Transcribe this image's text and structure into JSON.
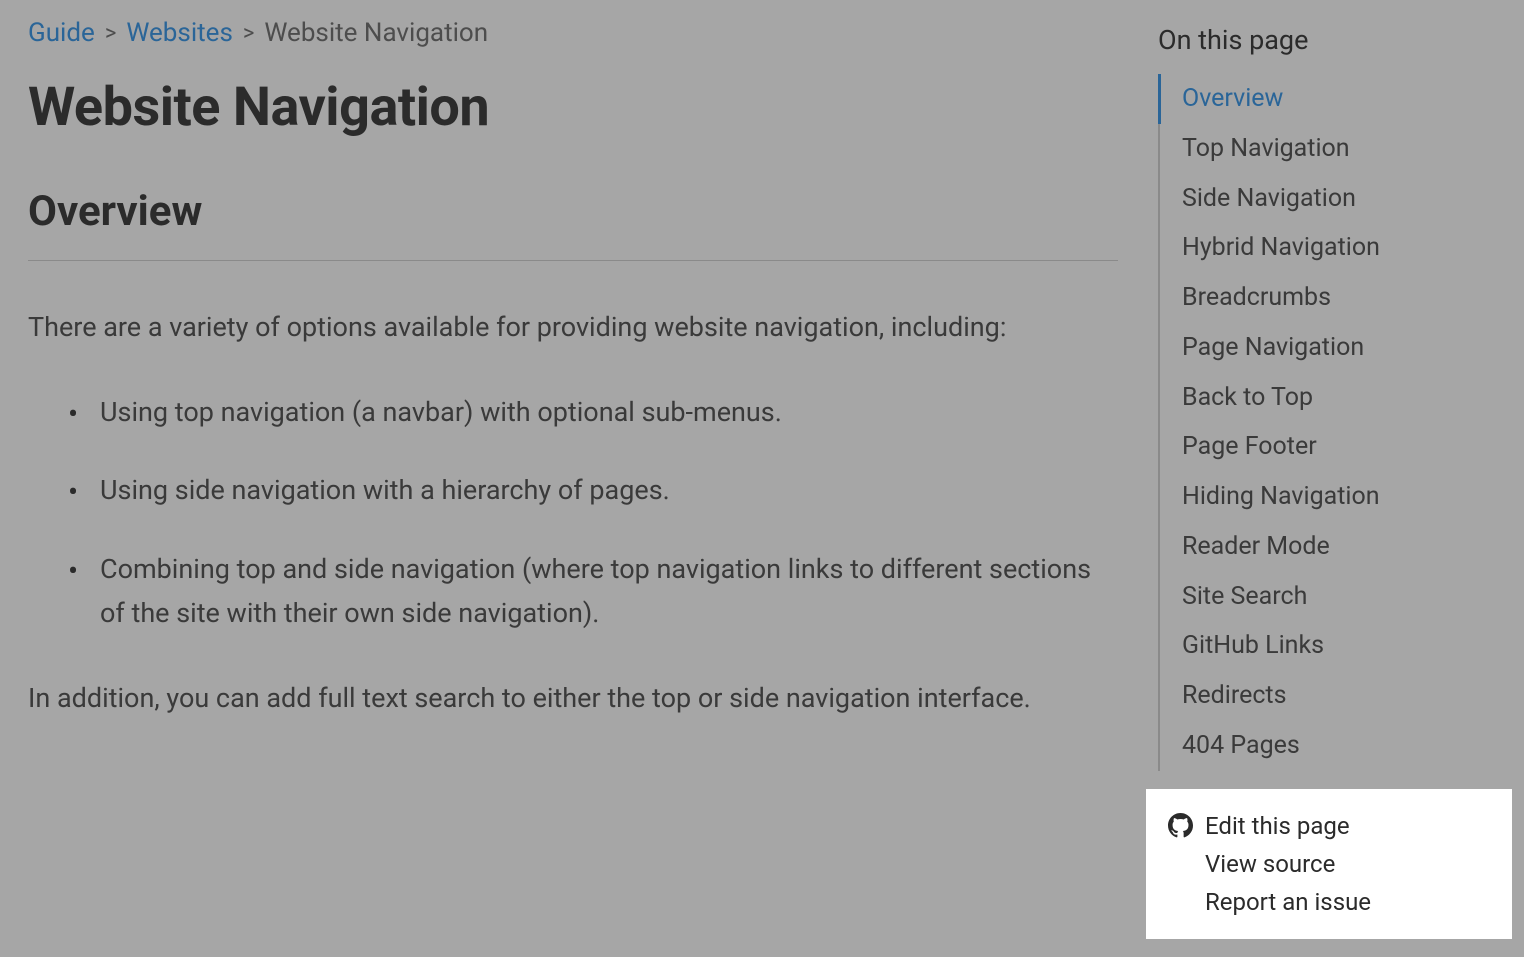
{
  "breadcrumb": {
    "items": [
      {
        "label": "Guide",
        "link": true
      },
      {
        "label": "Websites",
        "link": true
      },
      {
        "label": "Website Navigation",
        "link": false
      }
    ]
  },
  "page": {
    "title": "Website Navigation",
    "section_heading": "Overview",
    "intro": "There are a variety of options available for providing website navigation, including:",
    "bullets": [
      "Using top navigation (a navbar) with optional sub-menus.",
      "Using side navigation with a hierarchy of pages.",
      "Combining top and side navigation (where top navigation links to different sections of the site with their own side navigation)."
    ],
    "outro": "In addition, you can add full text search to either the top or side navigation interface."
  },
  "toc": {
    "title": "On this page",
    "items": [
      "Overview",
      "Top Navigation",
      "Side Navigation",
      "Hybrid Navigation",
      "Breadcrumbs",
      "Page Navigation",
      "Back to Top",
      "Page Footer",
      "Hiding Navigation",
      "Reader Mode",
      "Site Search",
      "GitHub Links",
      "Redirects",
      "404 Pages"
    ],
    "active_index": 0
  },
  "actions": {
    "edit": "Edit this page",
    "view_source": "View source",
    "report_issue": "Report an issue"
  }
}
